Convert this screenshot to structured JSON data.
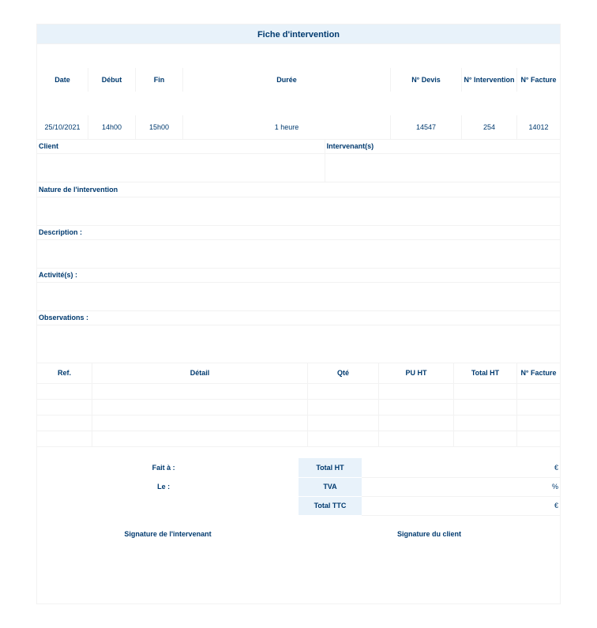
{
  "title": "Fiche d'intervention",
  "header": {
    "labels": {
      "date": "Date",
      "debut": "Début",
      "fin": "Fin",
      "duree": "Durée",
      "devis": "N° Devis",
      "intervention": "N° Intervention",
      "facture": "N° Facture"
    },
    "values": {
      "date": "25/10/2021",
      "debut": "14h00",
      "fin": "15h00",
      "duree": "1 heure",
      "devis": "14547",
      "intervention": "254",
      "facture": "14012"
    }
  },
  "parties": {
    "client_label": "Client",
    "client_value": "",
    "intervenant_label": "Intervenant(s)",
    "intervenant_value": ""
  },
  "sections": {
    "nature_label": "Nature de l'intervention",
    "nature_value": "",
    "description_label": "Description :",
    "description_value": "",
    "activites_label": "Activité(s) :",
    "activites_value": "",
    "observations_label": "Observations :",
    "observations_value": ""
  },
  "items": {
    "labels": {
      "ref": "Ref.",
      "detail": "Détail",
      "qte": "Qté",
      "puht": "PU HT",
      "totalht": "Total HT",
      "facture": "N° Facture"
    }
  },
  "closing": {
    "fait_a_label": "Fait à :",
    "fait_a_value": "",
    "le_label": "Le :",
    "le_value": ""
  },
  "totals": {
    "labels": {
      "ht": "Total HT",
      "tva": "TVA",
      "ttc": "Total TTC"
    },
    "values": {
      "ht": "€",
      "tva": "%",
      "ttc": "€"
    }
  },
  "signatures": {
    "intervenant": "Signature de l'intervenant",
    "client": "Signature du client"
  }
}
